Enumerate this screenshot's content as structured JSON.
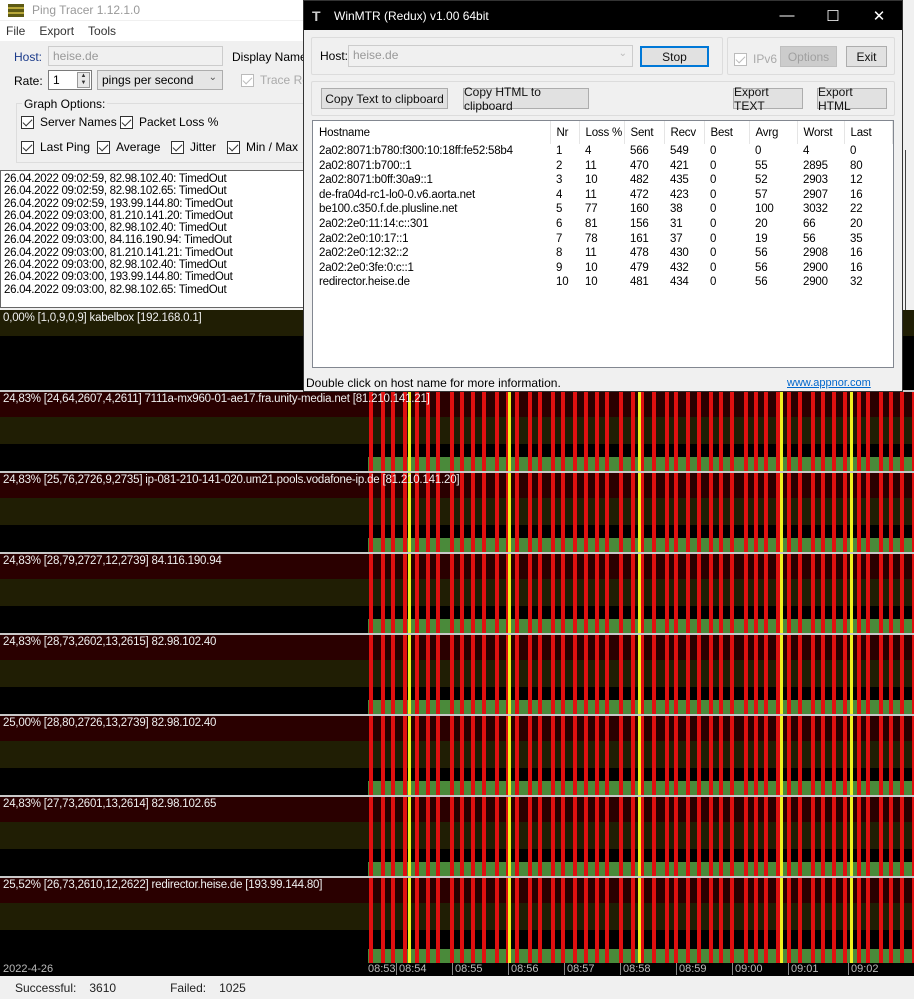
{
  "ping_tracer": {
    "title": "Ping Tracer 1.12.1.0",
    "menu": [
      "File",
      "Export",
      "Tools"
    ],
    "host_label": "Host:",
    "host_value": "heise.de",
    "display_name_label": "Display Name:",
    "rate_label": "Rate:",
    "rate_value": "1",
    "rate_unit": "pings per second",
    "trace_route_label": "Trace Ro",
    "graph_options_label": "Graph Options:",
    "options": [
      {
        "label": "Server Names",
        "checked": true
      },
      {
        "label": "Packet Loss %",
        "checked": true
      },
      {
        "label": "Last Ping",
        "checked": true
      },
      {
        "label": "Average",
        "checked": true
      },
      {
        "label": "Jitter",
        "checked": true
      },
      {
        "label": "Min / Max",
        "checked": true
      }
    ],
    "log": [
      "26.04.2022 09:02:59, 82.98.102.40: TimedOut",
      "26.04.2022 09:02:59, 82.98.102.65: TimedOut",
      "26.04.2022 09:02:59, 193.99.144.80: TimedOut",
      "26.04.2022 09:03:00, 81.210.141.20: TimedOut",
      "26.04.2022 09:03:00, 82.98.102.40: TimedOut",
      "26.04.2022 09:03:00, 84.116.190.94: TimedOut",
      "26.04.2022 09:03:00, 81.210.141.21: TimedOut",
      "26.04.2022 09:03:00, 82.98.102.40: TimedOut",
      "26.04.2022 09:03:00, 193.99.144.80: TimedOut",
      "26.04.2022 09:03:00, 82.98.102.65: TimedOut"
    ],
    "graphs": [
      {
        "label": "0,00% [1,0,9,0,9] kabelbox [192.168.0.1]",
        "loss": false
      },
      {
        "label": "24,83%  [24,64,2607,4,2611] 7111a-mx960-01-ae17.fra.unity-media.net  [81.210.141.21]",
        "loss": true
      },
      {
        "label": "24,83%  [25,76,2726,9,2735] ip-081-210-141-020.um21.pools.vodafone-ip.de  [81.210.141.20]",
        "loss": true
      },
      {
        "label": "24,83% [28,79,2727,12,2739] 84.116.190.94",
        "loss": true
      },
      {
        "label": "24,83% [28,73,2602,13,2615] 82.98.102.40",
        "loss": true
      },
      {
        "label": "25,00% [28,80,2726,13,2739] 82.98.102.40",
        "loss": true
      },
      {
        "label": "24,83% [27,73,2601,13,2614] 82.98.102.65",
        "loss": true
      },
      {
        "label": "25,52% [26,73,2610,12,2622] redirector.heise.de [193.99.144.80]",
        "loss": true
      }
    ],
    "date": "2022-4-26",
    "time_ticks": [
      "08:53",
      "08:54",
      "08:55",
      "08:56",
      "08:57",
      "08:58",
      "08:59",
      "09:00",
      "09:01",
      "09:02"
    ],
    "successful_label": "Successful:",
    "successful_value": "3610",
    "failed_label": "Failed:",
    "failed_value": "1025",
    "colors": {
      "timeout": "#e01010",
      "spike": "#f0f020",
      "ok": "#4a8a3a",
      "loss_bg": "#2a0000"
    }
  },
  "winmtr": {
    "title": "WinMTR (Redux) v1.00 64bit",
    "host_label": "Host:",
    "host_value": "heise.de",
    "stop_label": "Stop",
    "ipv6_label": "IPv6",
    "options_label": "Options",
    "exit_label": "Exit",
    "copy_text_label": "Copy Text to clipboard",
    "copy_html_label": "Copy HTML to clipboard",
    "export_text_label": "Export TEXT",
    "export_html_label": "Export HTML",
    "columns": [
      "Hostname",
      "Nr",
      "Loss %",
      "Sent",
      "Recv",
      "Best",
      "Avrg",
      "Worst",
      "Last"
    ],
    "rows": [
      [
        "2a02:8071:b780:f300:10:18ff:fe52:58b4",
        "1",
        "4",
        "566",
        "549",
        "0",
        "0",
        "4",
        "0"
      ],
      [
        "2a02:8071:b700::1",
        "2",
        "11",
        "470",
        "421",
        "0",
        "55",
        "2895",
        "80"
      ],
      [
        "2a02:8071:b0ff:30a9::1",
        "3",
        "10",
        "482",
        "435",
        "0",
        "52",
        "2903",
        "12"
      ],
      [
        "de-fra04d-rc1-lo0-0.v6.aorta.net",
        "4",
        "11",
        "472",
        "423",
        "0",
        "57",
        "2907",
        "16"
      ],
      [
        "be100.c350.f.de.plusline.net",
        "5",
        "77",
        "160",
        "38",
        "0",
        "100",
        "3032",
        "22"
      ],
      [
        "2a02:2e0:11:14:c::301",
        "6",
        "81",
        "156",
        "31",
        "0",
        "20",
        "66",
        "20"
      ],
      [
        "2a02:2e0:10:17::1",
        "7",
        "78",
        "161",
        "37",
        "0",
        "19",
        "56",
        "35"
      ],
      [
        "2a02:2e0:12:32::2",
        "8",
        "11",
        "478",
        "430",
        "0",
        "56",
        "2908",
        "16"
      ],
      [
        "2a02:2e0:3fe:0:c::1",
        "9",
        "10",
        "479",
        "432",
        "0",
        "56",
        "2900",
        "16"
      ],
      [
        "redirector.heise.de",
        "10",
        "10",
        "481",
        "434",
        "0",
        "56",
        "2900",
        "32"
      ]
    ],
    "status_text": "Double click on host name for more information.",
    "link_text": "www.appnor.com"
  }
}
